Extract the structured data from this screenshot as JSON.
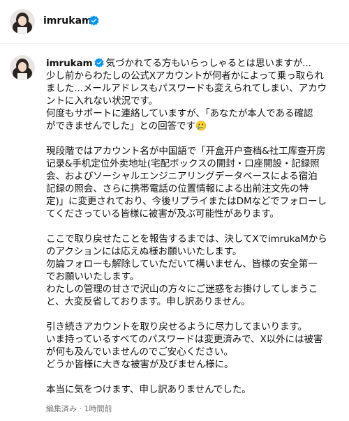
{
  "header": {
    "username": "imrukam",
    "verified_icon": "verified-badge-icon"
  },
  "post": {
    "username": "imrukam",
    "paragraphs": [
      [
        "気づかれてる方もいらっしゃるとは思いますが...",
        "少し前からわたしの公式Xアカウントが何者かによって乗っ取られ",
        "ました...メールアドレスもパスワードも変えられてしまい、アカウ",
        "ントに入れない状況です。",
        "何度もサポートに連絡していますが、「あなたが本人である確認",
        "ができませんでした」との回答です🥲"
      ],
      [
        "現段階ではアカウント名が中国語で「开盒开户查档&社工库查开房",
        "记录&手机定位外卖地址(宅配ボックスの開封・口座開設・記録照",
        "会、およびソーシャルエンジニアリングデータベースによる宿泊",
        "記録の照会、さらに携帯電話の位置情報による出前注文先の特",
        "定)」に変更されており、今後リプライまたはDMなどでフォローし",
        "てくださっている皆様に被害が及ぶ可能性があります。"
      ],
      [
        "ここで取り戻せたことを報告するまでは、決してXでimrukaMから",
        "のアクションには応えぬ様お願いいたします。",
        "勿論フォローも解除していただいて構いません、皆様の安全第一",
        "でお願いいたします。",
        "わたしの管理の甘さで沢山の方々にご迷惑をお掛けしてしまうこ",
        "と、大変反省しております。申し訳ありません。"
      ],
      [
        "引き続きアカウントを取り戻せるように尽力してまいります。",
        "いま持っているすべてのパスワードは変更済みで、X以外には被害",
        "が何も及んでいませんのでご安心ください。",
        "どうか皆様に大きな被害が及びません様に。"
      ],
      [
        "本当に気をつけます、申し訳ありませんでした。"
      ]
    ],
    "meta": "編集済み · 1時間前"
  }
}
